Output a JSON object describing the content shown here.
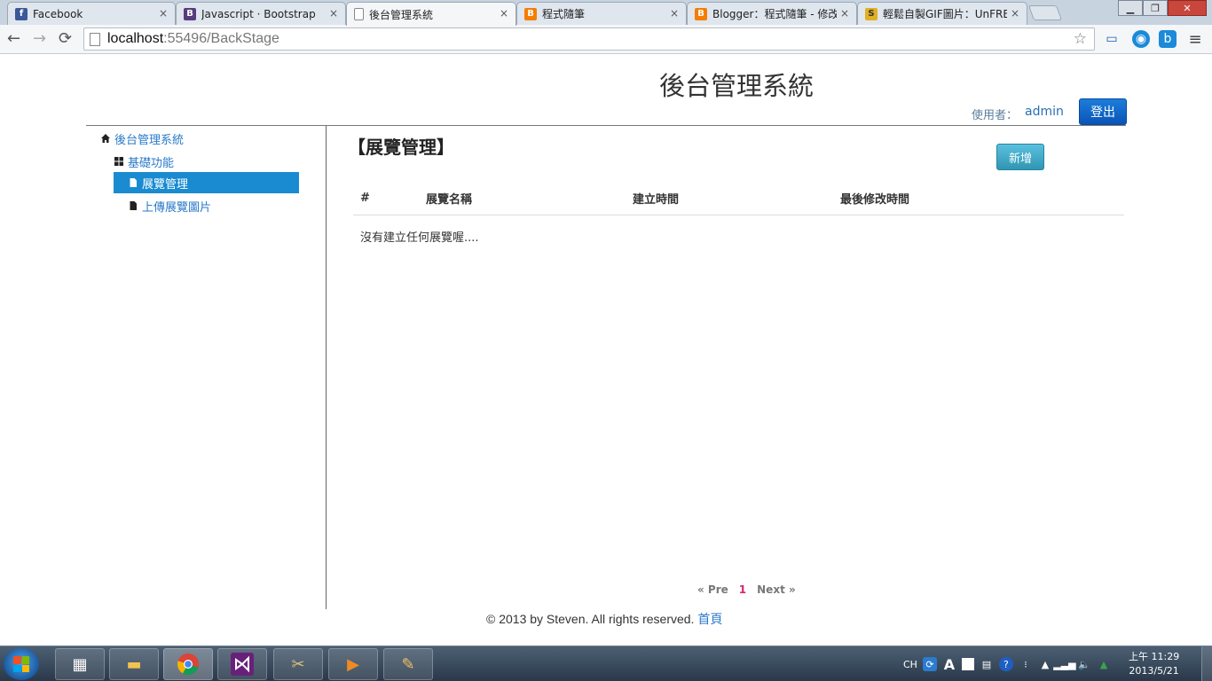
{
  "browser": {
    "tabs": [
      {
        "title": "Facebook",
        "favicon": "f",
        "favicon_color": "#3b5998",
        "active": false
      },
      {
        "title": "Javascript · Bootstrap",
        "favicon": "B",
        "favicon_color": "#563d7c",
        "active": false
      },
      {
        "title": "後台管理系統",
        "favicon": "",
        "favicon_color": "#ffffff",
        "active": true
      },
      {
        "title": "程式隨筆",
        "favicon": "B",
        "favicon_color": "#f57d00",
        "active": false
      },
      {
        "title": "Blogger：程式隨筆 - 修改",
        "favicon": "B",
        "favicon_color": "#f57d00",
        "active": false
      },
      {
        "title": "輕鬆自製GIF圖片：UnFRE",
        "favicon": "S",
        "favicon_color": "#e0b020",
        "active": false
      }
    ],
    "tab_close": "×",
    "url_host": "localhost",
    "url_path": ":55496/BackStage"
  },
  "header": {
    "title": "後台管理系統",
    "user_label": "使用者：",
    "user_name": "admin",
    "logout_label": "登出"
  },
  "sidebar": {
    "items": [
      {
        "label": "後台管理系統",
        "icon": "home-icon",
        "level": 0,
        "active": false
      },
      {
        "label": "基礎功能",
        "icon": "grid-icon",
        "level": 1,
        "active": false
      },
      {
        "label": "展覽管理",
        "icon": "file-icon",
        "level": 2,
        "active": true
      },
      {
        "label": "上傳展覽圖片",
        "icon": "file-icon",
        "level": 2,
        "active": false
      }
    ]
  },
  "main": {
    "section_title": "【展覽管理】",
    "add_label": "新增",
    "table": {
      "columns": [
        "#",
        "展覽名稱",
        "建立時間",
        "最後修改時間"
      ],
      "empty_message": "沒有建立任何展覽喔...."
    },
    "pager": {
      "prev_label": "« Pre",
      "current_page": "1",
      "next_label": "Next »"
    }
  },
  "footer": {
    "text": "© 2013 by Steven. All rights reserved.",
    "home_link": "首頁"
  },
  "taskbar": {
    "tray_lang": "CH",
    "clock_time": "上午 11:29",
    "clock_date": "2013/5/21"
  },
  "colors": {
    "accent": "#1a8bd0",
    "link": "#2a7ac9",
    "logout_button": "#0a54b6",
    "add_button": "#2f96b4",
    "pager_current": "#d6246e"
  }
}
